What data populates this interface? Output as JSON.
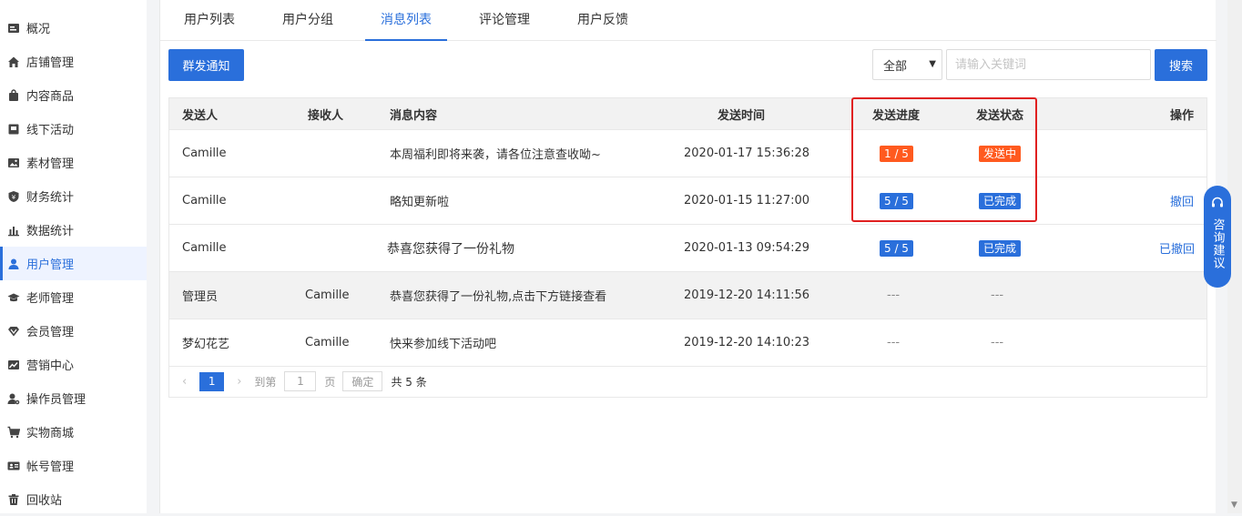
{
  "sidebar": {
    "items": [
      {
        "label": "概况",
        "icon": "dashboard-icon",
        "active": false
      },
      {
        "label": "店铺管理",
        "icon": "home-icon",
        "active": false
      },
      {
        "label": "内容商品",
        "icon": "bag-icon",
        "active": false
      },
      {
        "label": "线下活动",
        "icon": "flag-icon",
        "active": false
      },
      {
        "label": "素材管理",
        "icon": "image-icon",
        "active": false
      },
      {
        "label": "财务统计",
        "icon": "yen-shield-icon",
        "active": false
      },
      {
        "label": "数据统计",
        "icon": "bar-chart-icon",
        "active": false
      },
      {
        "label": "用户管理",
        "icon": "user-icon",
        "active": true
      },
      {
        "label": "老师管理",
        "icon": "graduation-cap-icon",
        "active": false
      },
      {
        "label": "会员管理",
        "icon": "diamond-icon",
        "active": false
      },
      {
        "label": "营销中心",
        "icon": "trend-icon",
        "active": false
      },
      {
        "label": "操作员管理",
        "icon": "user-gear-icon",
        "active": false
      },
      {
        "label": "实物商城",
        "icon": "cart-icon",
        "active": false
      },
      {
        "label": "帐号管理",
        "icon": "id-card-icon",
        "active": false
      },
      {
        "label": "回收站",
        "icon": "trash-icon",
        "active": false
      }
    ]
  },
  "tabs": [
    {
      "label": "用户列表",
      "active": false
    },
    {
      "label": "用户分组",
      "active": false
    },
    {
      "label": "消息列表",
      "active": true
    },
    {
      "label": "评论管理",
      "active": false
    },
    {
      "label": "用户反馈",
      "active": false
    }
  ],
  "toolbar": {
    "broadcast_label": "群发通知",
    "filter_value": "全部",
    "search_placeholder": "请输入关键词",
    "search_label": "搜索"
  },
  "table": {
    "headers": {
      "sender": "发送人",
      "receiver": "接收人",
      "content": "消息内容",
      "time": "发送时间",
      "progress": "发送进度",
      "status": "发送状态",
      "action": "操作"
    },
    "rows": [
      {
        "sender": "Camille",
        "receiver": "",
        "content": "本周福利即将来袭，请各位注意查收呦~",
        "time": "2020-01-17 15:36:28",
        "progress": "1 / 5",
        "progress_color": "#ff5a1f",
        "status": "发送中",
        "status_color": "#ff5a1f",
        "action": ""
      },
      {
        "sender": "Camille",
        "receiver": "",
        "content": "略知更新啦",
        "time": "2020-01-15 11:27:00",
        "progress": "5 / 5",
        "progress_color": "#2a6fdb",
        "status": "已完成",
        "status_color": "#2a6fdb",
        "action": "撤回"
      },
      {
        "sender": "Camille",
        "receiver": "",
        "content": "恭喜您获得了一份礼物",
        "time": "2020-01-13 09:54:29",
        "progress": "5 / 5",
        "progress_color": "#2a6fdb",
        "status": "已完成",
        "status_color": "#2a6fdb",
        "action": "已撤回"
      },
      {
        "sender": "管理员",
        "receiver": "Camille",
        "content": "恭喜您获得了一份礼物,点击下方链接查看",
        "time": "2019-12-20 14:11:56",
        "progress": "---",
        "status": "---",
        "action": ""
      },
      {
        "sender": "梦幻花艺",
        "receiver": "Camille",
        "content": "快来参加线下活动吧",
        "time": "2019-12-20 14:10:23",
        "progress": "---",
        "status": "---",
        "action": ""
      }
    ]
  },
  "pagination": {
    "current_page": "1",
    "goto_prefix": "到第",
    "goto_value": "1",
    "goto_suffix": "页",
    "confirm_label": "确定",
    "total_text": "共 5 条"
  },
  "float_button": {
    "label": "咨询建议",
    "icon": "headset-icon"
  },
  "colors": {
    "accent": "#2a6fdb",
    "warning": "#ff5a1f",
    "highlight_box": "#e02020"
  }
}
